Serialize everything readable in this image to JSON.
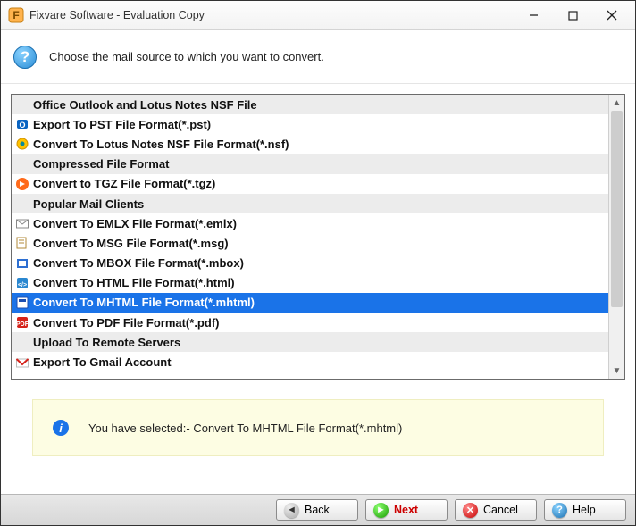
{
  "window": {
    "title": "Fixvare Software - Evaluation Copy"
  },
  "instruction": "Choose the mail source to which you want to convert.",
  "rows": [
    {
      "type": "header",
      "label": "Office Outlook and Lotus Notes NSF File",
      "icon": null
    },
    {
      "type": "item",
      "label": "Export To PST File Format(*.pst)",
      "icon": "outlook"
    },
    {
      "type": "item",
      "label": "Convert To Lotus Notes NSF File Format(*.nsf)",
      "icon": "lotus"
    },
    {
      "type": "header",
      "label": "Compressed File Format",
      "icon": null
    },
    {
      "type": "item",
      "label": "Convert to TGZ File Format(*.tgz)",
      "icon": "tgz"
    },
    {
      "type": "header",
      "label": "Popular Mail Clients",
      "icon": null
    },
    {
      "type": "item",
      "label": "Convert To EMLX File Format(*.emlx)",
      "icon": "emlx"
    },
    {
      "type": "item",
      "label": "Convert To MSG File Format(*.msg)",
      "icon": "msg"
    },
    {
      "type": "item",
      "label": "Convert To MBOX File Format(*.mbox)",
      "icon": "mbox"
    },
    {
      "type": "item",
      "label": "Convert To HTML File Format(*.html)",
      "icon": "html"
    },
    {
      "type": "item",
      "label": "Convert To MHTML File Format(*.mhtml)",
      "icon": "mhtml",
      "selected": true
    },
    {
      "type": "item",
      "label": "Convert To PDF File Format(*.pdf)",
      "icon": "pdf"
    },
    {
      "type": "header",
      "label": "Upload To Remote Servers",
      "icon": null
    },
    {
      "type": "item",
      "label": "Export To Gmail Account",
      "icon": "gmail"
    }
  ],
  "status": {
    "message": "You have selected:- Convert To MHTML File Format(*.mhtml)"
  },
  "buttons": {
    "back": "Back",
    "next": "Next",
    "cancel": "Cancel",
    "help": "Help"
  }
}
